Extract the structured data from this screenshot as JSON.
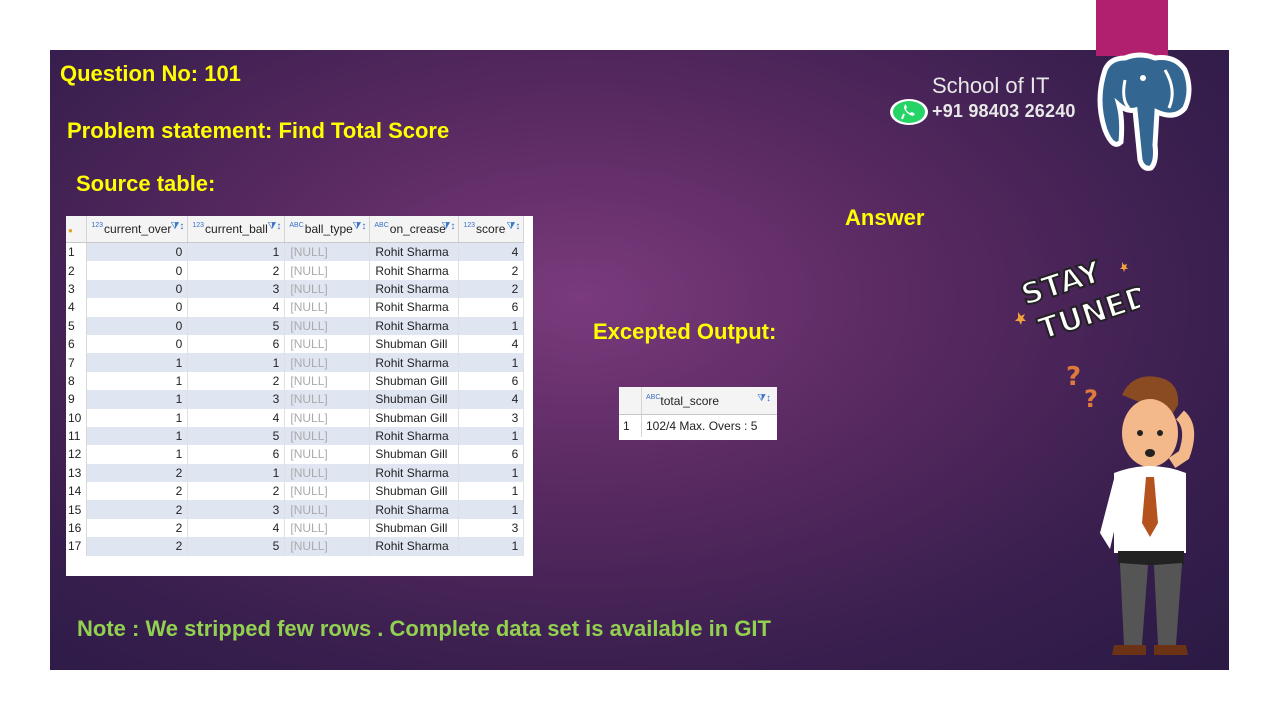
{
  "question": "Question No: 101",
  "problem": "Problem statement: Find Total Score",
  "source_label": "Source table:",
  "answer_label": "Answer",
  "expected_label": "Excepted Output:",
  "note": "Note : We stripped few rows . Complete data set is available in GIT",
  "brand": {
    "name": "School of IT",
    "phone": "+91 98403 26240"
  },
  "source_table": {
    "columns": [
      {
        "type": "123",
        "name": "current_over"
      },
      {
        "type": "123",
        "name": "current_ball"
      },
      {
        "type": "ABC",
        "name": "ball_type"
      },
      {
        "type": "ABC",
        "name": "on_crease"
      },
      {
        "type": "123",
        "name": "score"
      }
    ],
    "rows": [
      [
        "1",
        "0",
        "1",
        "[NULL]",
        "Rohit Sharma",
        "4"
      ],
      [
        "2",
        "0",
        "2",
        "[NULL]",
        "Rohit Sharma",
        "2"
      ],
      [
        "3",
        "0",
        "3",
        "[NULL]",
        "Rohit Sharma",
        "2"
      ],
      [
        "4",
        "0",
        "4",
        "[NULL]",
        "Rohit Sharma",
        "6"
      ],
      [
        "5",
        "0",
        "5",
        "[NULL]",
        "Rohit Sharma",
        "1"
      ],
      [
        "6",
        "0",
        "6",
        "[NULL]",
        "Shubman Gill",
        "4"
      ],
      [
        "7",
        "1",
        "1",
        "[NULL]",
        "Rohit Sharma",
        "1"
      ],
      [
        "8",
        "1",
        "2",
        "[NULL]",
        "Shubman Gill",
        "6"
      ],
      [
        "9",
        "1",
        "3",
        "[NULL]",
        "Shubman Gill",
        "4"
      ],
      [
        "10",
        "1",
        "4",
        "[NULL]",
        "Shubman Gill",
        "3"
      ],
      [
        "11",
        "1",
        "5",
        "[NULL]",
        "Rohit Sharma",
        "1"
      ],
      [
        "12",
        "1",
        "6",
        "[NULL]",
        "Shubman Gill",
        "6"
      ],
      [
        "13",
        "2",
        "1",
        "[NULL]",
        "Rohit Sharma",
        "1"
      ],
      [
        "14",
        "2",
        "2",
        "[NULL]",
        "Shubman Gill",
        "1"
      ],
      [
        "15",
        "2",
        "3",
        "[NULL]",
        "Rohit Sharma",
        "1"
      ],
      [
        "16",
        "2",
        "4",
        "[NULL]",
        "Shubman Gill",
        "3"
      ],
      [
        "17",
        "2",
        "5",
        "[NULL]",
        "Rohit Sharma",
        "1"
      ]
    ]
  },
  "output_table": {
    "column": {
      "type": "ABC",
      "name": "total_score"
    },
    "row_num": "1",
    "value": "102/4   Max. Overs :   5"
  },
  "images": {
    "logo": "postgresql-elephant-icon",
    "sticker": "stay-tuned-sticker",
    "character": "confused-man-illustration"
  },
  "stay_tuned_text": [
    "STAY",
    "TUNED"
  ],
  "colors": {
    "heading": "#ffff00",
    "note": "#92d050",
    "accent": "#b11f6f"
  }
}
